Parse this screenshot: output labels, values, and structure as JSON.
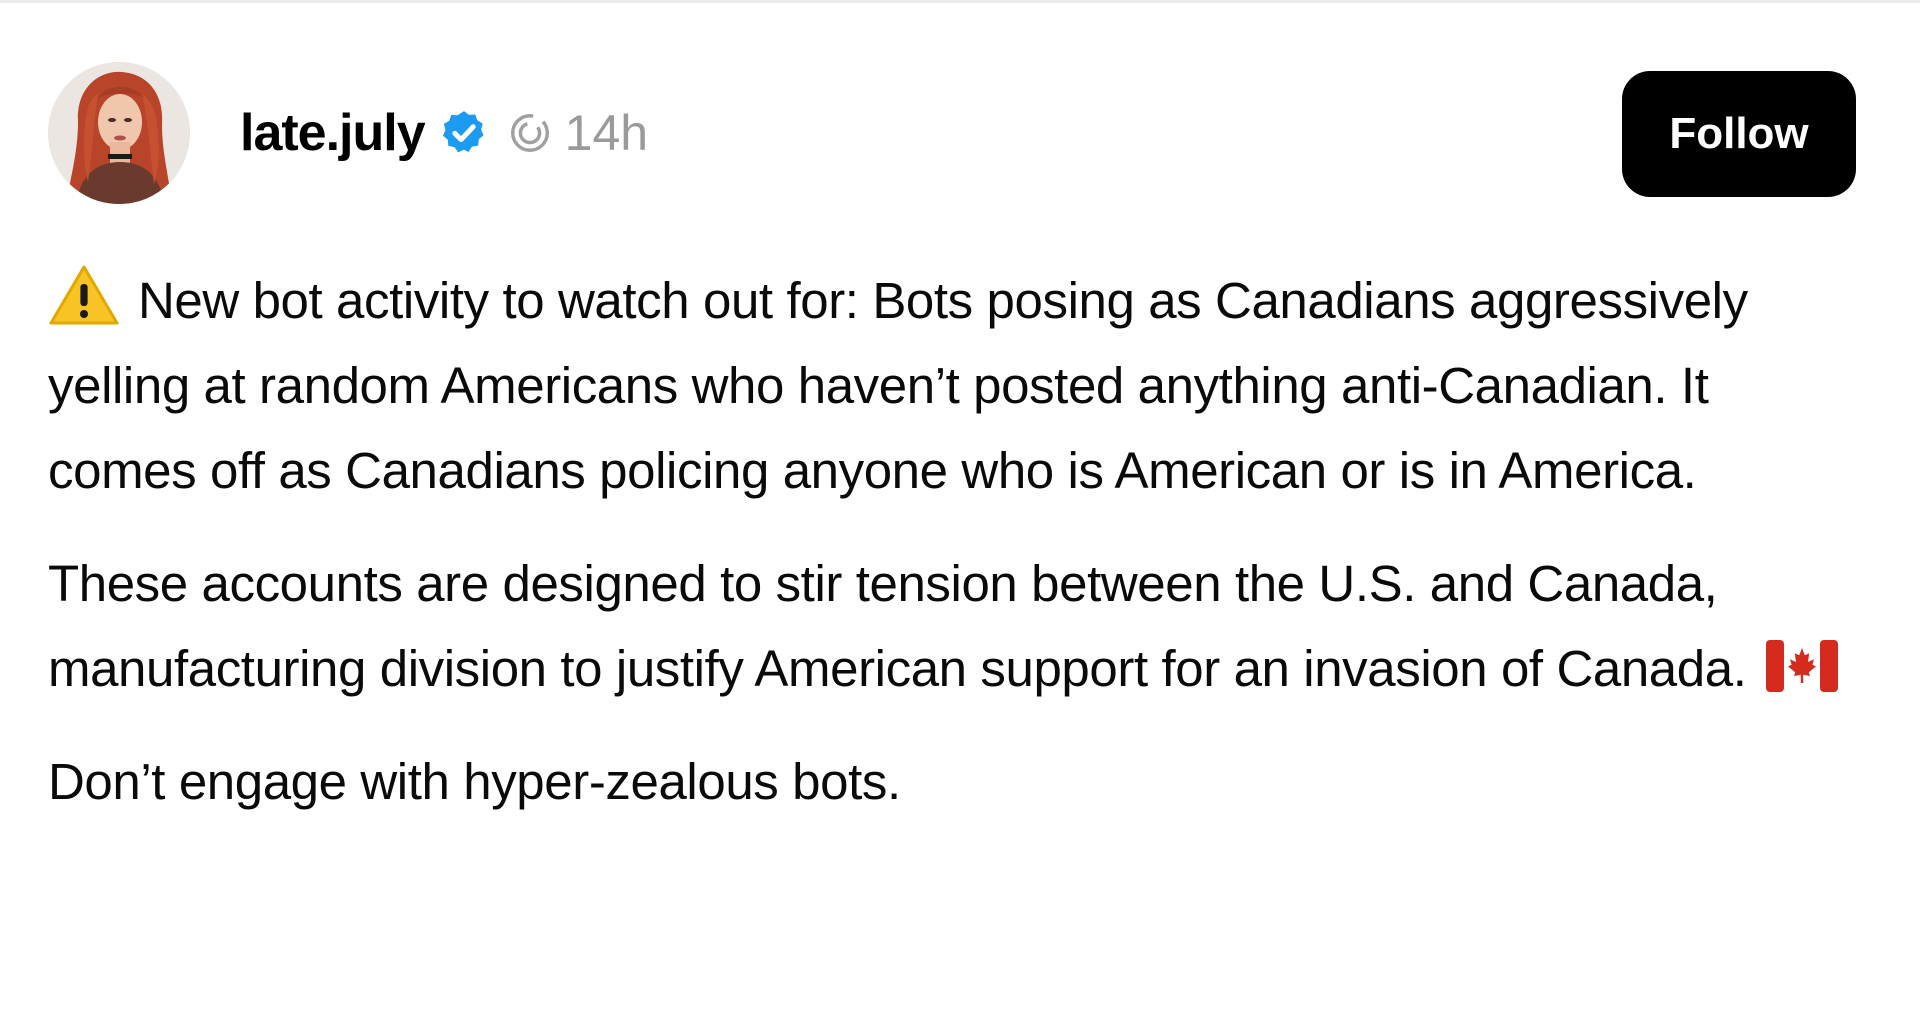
{
  "post": {
    "author": {
      "username": "late.july",
      "avatar_icon": "profile-photo",
      "verified_icon": "verified-badge-icon",
      "verified_color": "#1d9bf0"
    },
    "thread_icon": "threads-icon",
    "timestamp": "14h",
    "follow_label": "Follow",
    "paragraphs": [
      {
        "leading_icon": "warning-icon",
        "text": "New bot activity to watch out for: Bots posing as Canadians aggressively yelling at random Americans who haven’t posted anything anti-Canadian. It comes off as Canadians policing anyone who is American or is in America."
      },
      {
        "text": "These accounts are designed to stir tension between the U.S. and Canada, manufacturing division to justify American support for an invasion of Canada.",
        "trailing_icon": "canada-flag-icon"
      },
      {
        "text": "Don’t engage with hyper-zealous bots."
      }
    ]
  },
  "colors": {
    "text": "#0a0a0a",
    "muted": "#9a9a9a",
    "button_bg": "#000000",
    "button_text": "#ffffff",
    "canada_red": "#d52b1e",
    "warning_yellow": "#f7c325"
  }
}
